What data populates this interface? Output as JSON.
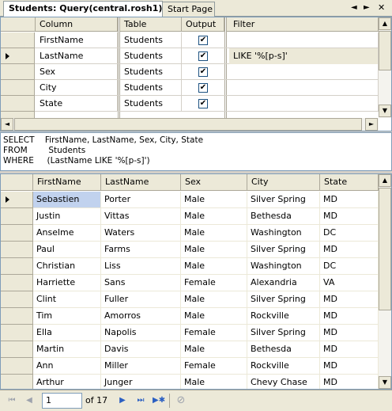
{
  "tabs": {
    "active": "Students: Query(central.rosh1)*",
    "inactive": "Start Page",
    "prev_icon": "◄",
    "next_icon": "►",
    "close_icon": "✕"
  },
  "criteria": {
    "headers": [
      "Column",
      "Table",
      "Output",
      "Filter"
    ],
    "rows": [
      {
        "column": "FirstName",
        "table": "Students",
        "output": true,
        "filter": ""
      },
      {
        "column": "LastName",
        "table": "Students",
        "output": true,
        "filter": "LIKE '%[p-s]'"
      },
      {
        "column": "Sex",
        "table": "Students",
        "output": true,
        "filter": ""
      },
      {
        "column": "City",
        "table": "Students",
        "output": true,
        "filter": ""
      },
      {
        "column": "State",
        "table": "Students",
        "output": true,
        "filter": ""
      }
    ]
  },
  "sql": {
    "line1": "SELECT    FirstName, LastName, Sex, City, State",
    "line2": "FROM        Students",
    "line3": "WHERE     (LastName LIKE '%[p-s]')"
  },
  "results": {
    "headers": [
      "FirstName",
      "LastName",
      "Sex",
      "City",
      "State"
    ],
    "rows": [
      [
        "Sebastien",
        "Porter",
        "Male",
        "Silver Spring",
        "MD"
      ],
      [
        "Justin",
        "Vittas",
        "Male",
        "Bethesda",
        "MD"
      ],
      [
        "Anselme",
        "Waters",
        "Male",
        "Washington",
        "DC"
      ],
      [
        "Paul",
        "Farms",
        "Male",
        "Silver Spring",
        "MD"
      ],
      [
        "Christian",
        "Liss",
        "Male",
        "Washington",
        "DC"
      ],
      [
        "Harriette",
        "Sans",
        "Female",
        "Alexandria",
        "VA"
      ],
      [
        "Clint",
        "Fuller",
        "Male",
        "Silver Spring",
        "MD"
      ],
      [
        "Tim",
        "Amorros",
        "Male",
        "Rockville",
        "MD"
      ],
      [
        "Ella",
        "Napolis",
        "Female",
        "Silver Spring",
        "MD"
      ],
      [
        "Martin",
        "Davis",
        "Male",
        "Bethesda",
        "MD"
      ],
      [
        "Ann",
        "Miller",
        "Female",
        "Rockville",
        "MD"
      ],
      [
        "Arthur",
        "Junger",
        "Male",
        "Chevy Chase",
        "MD"
      ]
    ]
  },
  "nav": {
    "page": "1",
    "of_text": "of 17"
  }
}
